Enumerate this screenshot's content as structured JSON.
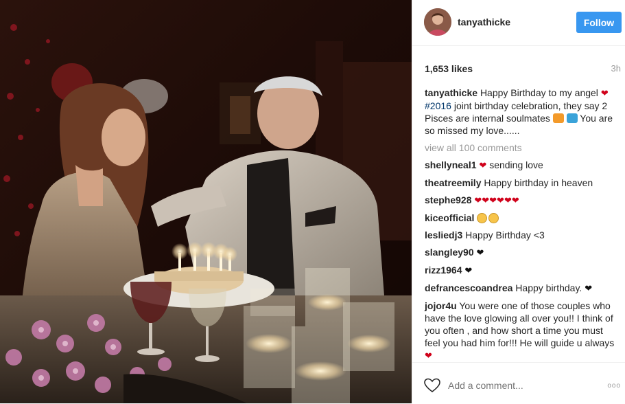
{
  "post": {
    "photo_alt": "",
    "username": "tanyathicke",
    "follow_label": "Follow",
    "likes": "1,653 likes",
    "time": "3h"
  },
  "caption": {
    "user": "tanyathicke",
    "text_1": "Happy Birthday to my angel",
    "hashtag": "#2016",
    "text_2": "joint birthday celebration, they say 2 Pisces are internal soulmates",
    "text_3": "You are so missed my love......"
  },
  "view_all": "view all 100 comments",
  "comments": [
    {
      "user": "shellyneal1",
      "text": "sending love",
      "emoji": "red-heart-icon"
    },
    {
      "user": "theatreemily",
      "text": "Happy birthday in heaven"
    },
    {
      "user": "stephe928",
      "text": "",
      "emoji": "red-hearts-icon"
    },
    {
      "user": "kiceofficial",
      "text": "",
      "emoji": "sad-face-icon"
    },
    {
      "user": "lesliedj3",
      "text": "Happy Birthday <3"
    },
    {
      "user": "slangley90",
      "text": "",
      "emoji": "black-heart-icon"
    },
    {
      "user": "rizz1964",
      "text": "",
      "emoji": "black-heart-icon"
    },
    {
      "user": "defrancescoandrea",
      "text": "Happy birthday.",
      "emoji": "black-heart-icon"
    },
    {
      "user": "jojor4u",
      "text": "You were one of those couples who have the love glowing all over you!! I think of you often , and how short a time you must feel you had him for!!! He will guide u always",
      "emoji": "red-heart-icon"
    }
  ],
  "footer": {
    "add_comment_placeholder": "Add a comment...",
    "more_label": "ooo"
  },
  "colors": {
    "follow_button": "#3897f0",
    "heart": "#d0021b",
    "hashtag": "#003569"
  }
}
